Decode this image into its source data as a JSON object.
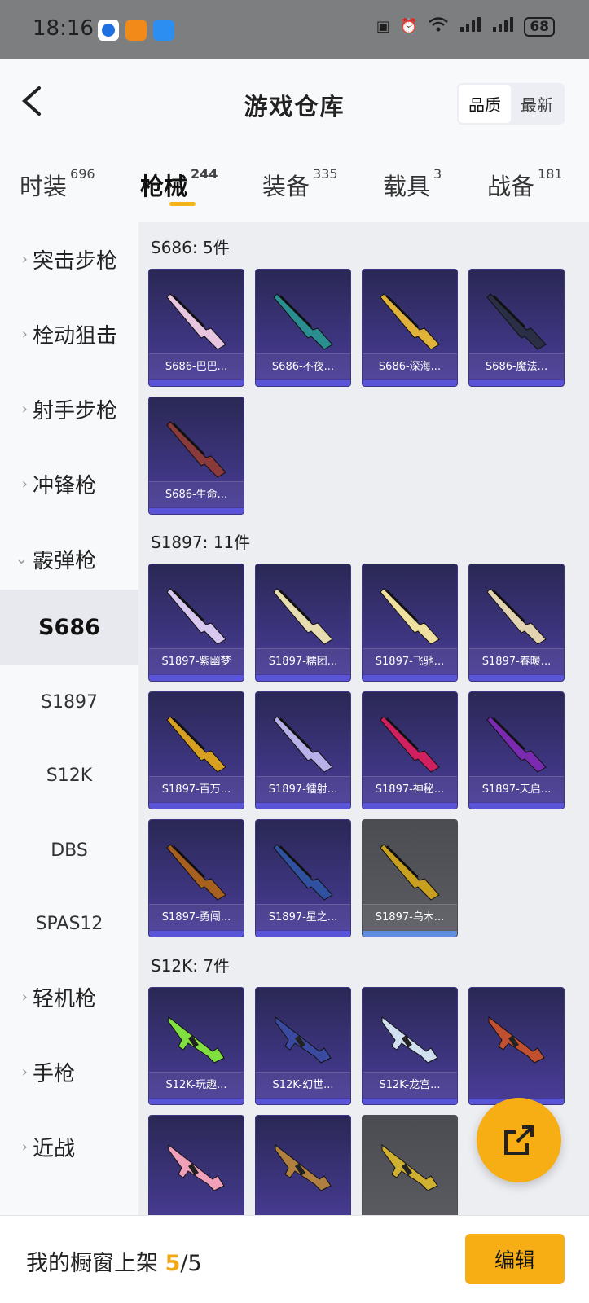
{
  "status": {
    "time": "18:16",
    "battery": "68"
  },
  "header": {
    "title": "游戏仓库",
    "sort_quality": "品质",
    "sort_latest": "最新"
  },
  "tabs": [
    {
      "label": "时装",
      "count": "696"
    },
    {
      "label": "枪械",
      "count": "244"
    },
    {
      "label": "装备",
      "count": "335"
    },
    {
      "label": "载具",
      "count": "3"
    },
    {
      "label": "战备",
      "count": "181"
    }
  ],
  "sidebar": {
    "items": [
      {
        "label": "突击步枪"
      },
      {
        "label": "栓动狙击"
      },
      {
        "label": "射手步枪"
      },
      {
        "label": "冲锋枪"
      },
      {
        "label": "霰弹枪"
      },
      {
        "label": "S686"
      },
      {
        "label": "S1897"
      },
      {
        "label": "S12K"
      },
      {
        "label": "DBS"
      },
      {
        "label": "SPAS12"
      },
      {
        "label": "轻机枪"
      },
      {
        "label": "手枪"
      },
      {
        "label": "近战"
      }
    ]
  },
  "sections": [
    {
      "title": "S686: 5件",
      "items": [
        "S686-巴巴...",
        "S686-不夜...",
        "S686-深海...",
        "S686-魔法...",
        "S686-生命..."
      ],
      "colors": [
        "#e8c6e0",
        "#2a8d8f",
        "#e0b23a",
        "#2b2f45",
        "#8a3a3a"
      ]
    },
    {
      "title": "S1897: 11件",
      "items": [
        "S1897-紫幽梦",
        "S1897-糯团...",
        "S1897-飞驰...",
        "S1897-春暖...",
        "S1897-百万...",
        "S1897-镭射...",
        "S1897-神秘...",
        "S1897-天启...",
        "S1897-勇闯...",
        "S1897-星之...",
        ""
      ],
      "colors": [
        "#d8c8f0",
        "#e8ddb0",
        "#f0e0a0",
        "#e4d3b0",
        "#d8a020",
        "#b8b0e8",
        "#d02060",
        "#7a2ab0",
        "#a86020",
        "#3050a0",
        "#c8a020"
      ]
    },
    {
      "title": "S12K: 7件",
      "items": [
        "S12K-玩趣...",
        "S12K-幻世...",
        "S12K-龙宫...",
        "",
        "",
        "",
        ""
      ],
      "colors": [
        "#80e040",
        "#3a4aa0",
        "#d0e0f0",
        "#c05030",
        "#f0a0b8",
        "#b08040",
        "#d0b030"
      ]
    }
  ],
  "section2_last_label": "S1897-乌木...",
  "footer": {
    "label": "我的橱窗上架",
    "current": "5",
    "sep": "/",
    "total": "5",
    "edit": "编辑"
  }
}
